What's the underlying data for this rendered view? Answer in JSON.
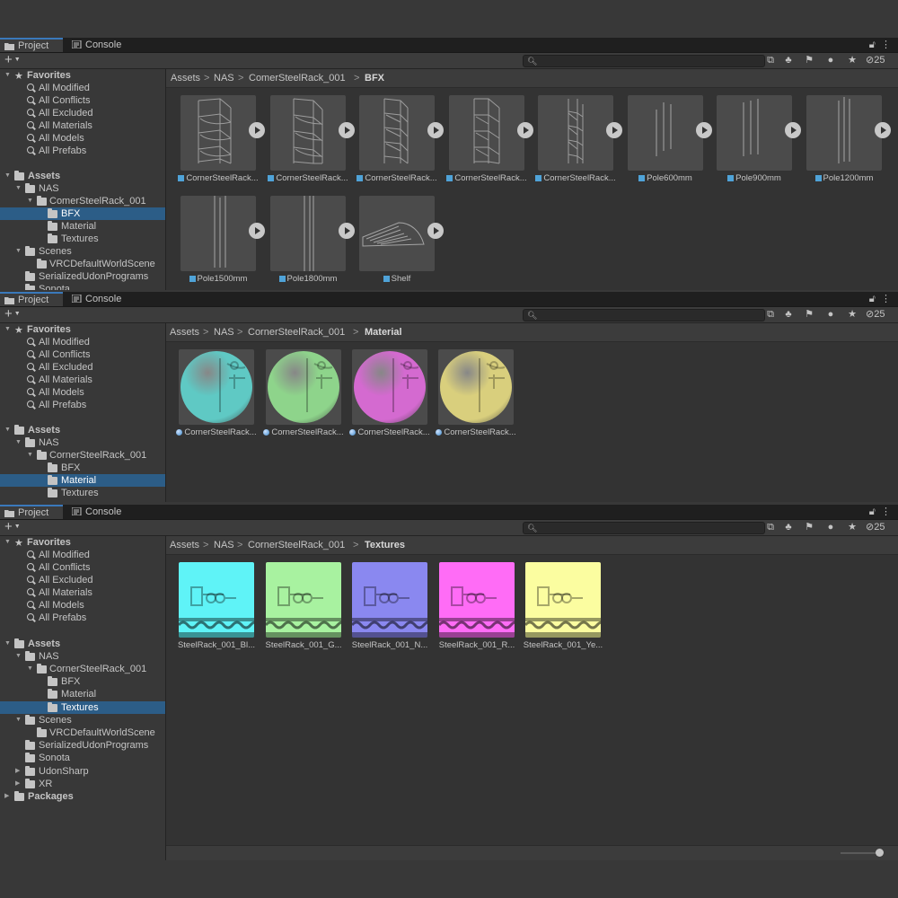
{
  "tabs": {
    "project": "Project",
    "console": "Console"
  },
  "toolbar": {
    "add": "+",
    "hidden_count": "25"
  },
  "sidebar_common": {
    "favorites": "Favorites",
    "fav_items": [
      "All Modified",
      "All Conflicts",
      "All Excluded",
      "All Materials",
      "All Models",
      "All Prefabs"
    ],
    "assets": "Assets",
    "nas": "NAS",
    "rack": "CornerSteelRack_001",
    "rack_misspelled": "ComerSteelRack_001",
    "bfx": "BFX",
    "material": "Material",
    "textures": "Textures",
    "scenes": "Scenes",
    "vrc_scene": "VRCDefaultWorldScene",
    "serialized": "SerializedUdonPrograms",
    "sonota": "Sonota",
    "udonsharp": "UdonSharp",
    "xr": "XR",
    "packages": "Packages",
    "cut_label": "Sonota"
  },
  "panel1": {
    "breadcrumb": [
      "Assets",
      "NAS",
      "ComerSteelRack_001",
      "BFX"
    ],
    "items": [
      "CornerSteelRack...",
      "CornerSteelRack...",
      "CornerSteelRack...",
      "CornerSteelRack...",
      "CornerSteelRack...",
      "Pole600mm",
      "Pole900mm",
      "Pole1200mm",
      "Pole1500mm",
      "Pole1800mm",
      "Shelf"
    ]
  },
  "panel2": {
    "breadcrumb": [
      "Assets",
      "NAS",
      "CornerSteelRack_001",
      "Material"
    ],
    "items": [
      "CornerSteelRack...",
      "CornerSteelRack...",
      "CornerSteelRack...",
      "CornerSteelRack..."
    ],
    "colors": [
      "#5fc9c4",
      "#8ed48b",
      "#d46ad0",
      "#d9cf7d"
    ]
  },
  "panel3": {
    "breadcrumb": [
      "Assets",
      "NAS",
      "CornerSteelRack_001",
      "Textures"
    ],
    "items": [
      "SteelRack_001_Bl...",
      "SteelRack_001_G...",
      "SteelRack_001_N...",
      "SteelRack_001_R...",
      "SteelRack_001_Ye..."
    ],
    "colors": [
      "#5ff3f7",
      "#a8f2a0",
      "#8a88f0",
      "#ff6cf6",
      "#fbfda0"
    ]
  }
}
